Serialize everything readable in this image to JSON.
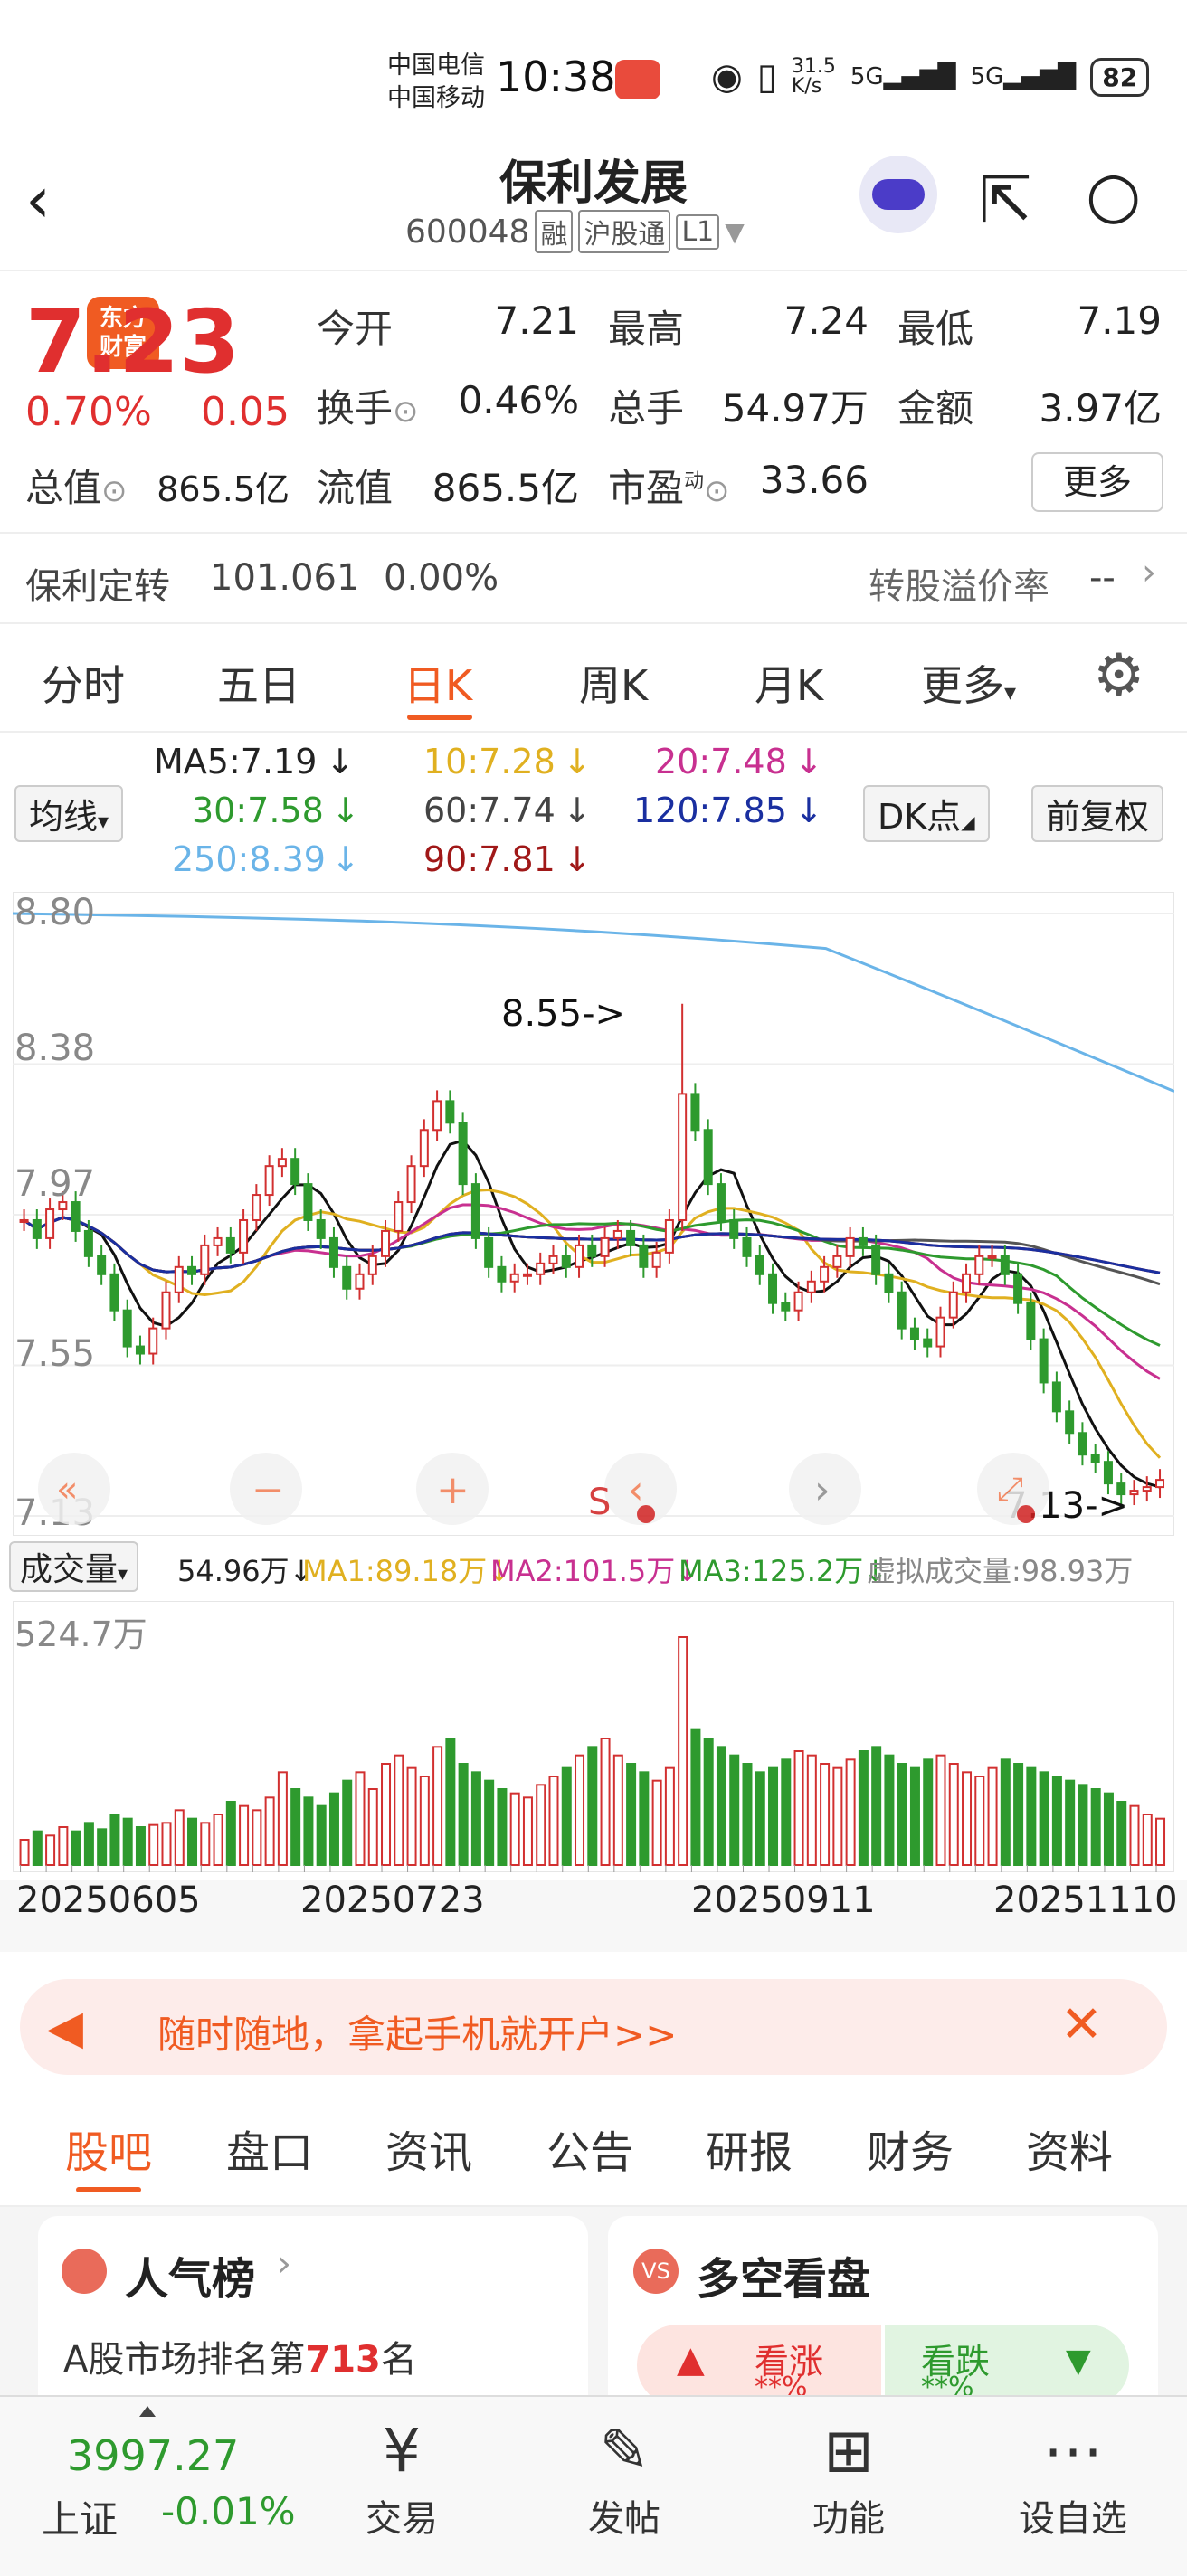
{
  "status": {
    "carrier1": "中国电信",
    "carrier2": "中国移动",
    "time": "10:38",
    "net_speed": "31.5\nK/s",
    "sig1": "5G",
    "sig2": "5G",
    "battery": "82"
  },
  "nav": {
    "title": "保利发展",
    "code": "600048",
    "tags": [
      "融",
      "沪股通",
      "L1"
    ]
  },
  "quote": {
    "price": "7.23",
    "pct": "0.70%",
    "chg": "0.05",
    "open_label": "今开",
    "open": "7.21",
    "high_label": "最高",
    "high": "7.24",
    "low_label": "最低",
    "low": "7.19",
    "turn_label": "换手",
    "turn": "0.46%",
    "vol_label": "总手",
    "vol": "54.97万",
    "amt_label": "金额",
    "amt": "3.97亿",
    "mcap_label": "总值",
    "mcap": "865.5亿",
    "float_label": "流值",
    "float": "865.5亿",
    "pe_label": "市盈",
    "pe_sup": "动",
    "pe": "33.66",
    "more": "更多"
  },
  "convert": {
    "name": "保利定转",
    "price": "101.061",
    "pct": "0.00%",
    "premium_label": "转股溢价率",
    "premium": "--"
  },
  "tabs": [
    "分时",
    "五日",
    "日K",
    "周K",
    "月K",
    "更多"
  ],
  "ma": {
    "btn": "均线",
    "ma5": "MA5:7.19",
    "ma10": "10:7.28",
    "ma20": "20:7.48",
    "ma30": "30:7.58",
    "ma60": "60:7.74",
    "ma120": "120:7.85",
    "ma250": "250:8.39",
    "ma90": "90:7.81",
    "dk": "DK点",
    "fq": "前复权"
  },
  "chart_data": {
    "type": "candlestick",
    "y_labels": [
      "8.80",
      "8.38",
      "7.97",
      "7.55",
      "7.13"
    ],
    "ylim": [
      7.13,
      8.8
    ],
    "annot_high": "8.55->",
    "annot_low": "7.13->",
    "closes": [
      7.95,
      7.9,
      7.98,
      8.0,
      7.92,
      7.85,
      7.8,
      7.7,
      7.6,
      7.58,
      7.65,
      7.75,
      7.82,
      7.8,
      7.88,
      7.9,
      7.86,
      7.95,
      8.02,
      8.1,
      8.12,
      8.05,
      7.95,
      7.9,
      7.82,
      7.76,
      7.8,
      7.85,
      7.92,
      8.0,
      8.1,
      8.2,
      8.28,
      8.22,
      8.05,
      7.9,
      7.82,
      7.78,
      7.8,
      7.8,
      7.83,
      7.85,
      7.82,
      7.88,
      7.85,
      7.9,
      7.92,
      7.88,
      7.82,
      7.86,
      7.95,
      8.3,
      8.2,
      8.05,
      7.95,
      7.9,
      7.85,
      7.8,
      7.72,
      7.7,
      7.75,
      7.78,
      7.82,
      7.85,
      7.9,
      7.88,
      7.8,
      7.75,
      7.65,
      7.62,
      7.6,
      7.68,
      7.75,
      7.8,
      7.85,
      7.85,
      7.8,
      7.72,
      7.62,
      7.5,
      7.42,
      7.36,
      7.3,
      7.28,
      7.22,
      7.19,
      7.2,
      7.21,
      7.23
    ]
  },
  "vol": {
    "label": "成交量",
    "cur": "54.96万",
    "ma1": "MA1:89.18万",
    "ma2": "MA2:101.5万",
    "ma3": "MA3:125.2万",
    "virt": "虚拟成交量:98.93万",
    "ymax": "524.7万",
    "values": [
      60,
      80,
      70,
      90,
      80,
      100,
      85,
      120,
      110,
      90,
      95,
      100,
      130,
      110,
      100,
      120,
      150,
      140,
      130,
      160,
      220,
      180,
      160,
      140,
      170,
      200,
      220,
      180,
      240,
      260,
      230,
      210,
      280,
      300,
      240,
      220,
      200,
      180,
      170,
      160,
      190,
      210,
      230,
      260,
      280,
      300,
      260,
      240,
      220,
      200,
      230,
      540,
      320,
      300,
      280,
      260,
      240,
      220,
      230,
      250,
      270,
      260,
      240,
      230,
      250,
      270,
      280,
      260,
      240,
      230,
      250,
      260,
      240,
      220,
      210,
      230,
      250,
      240,
      230,
      220,
      210,
      200,
      190,
      180,
      170,
      150,
      140,
      120,
      110
    ]
  },
  "dates": [
    "20250605",
    "20250723",
    "20250911",
    "20251110"
  ],
  "banner": "随时随地，拿起手机就开户>>",
  "btabs": [
    "股吧",
    "盘口",
    "资讯",
    "公告",
    "研报",
    "财务",
    "资料"
  ],
  "cards": {
    "rank_title": "人气榜",
    "rank_text": "A股市场排名第",
    "rank_num": "713",
    "rank_unit": "名",
    "bull_title": "多空看盘",
    "up": "看涨",
    "down": "看跌",
    "stars": "**%"
  },
  "bottom": {
    "index_val": "3997.27",
    "index_name": "上证",
    "index_pct": "-0.01%",
    "trade": "交易",
    "post": "发帖",
    "func": "功能",
    "watch": "设自选"
  }
}
